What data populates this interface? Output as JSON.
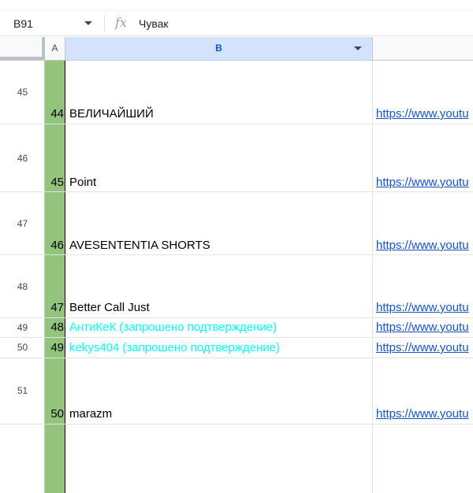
{
  "formula_bar": {
    "name_box": "B91",
    "fx_label": "fx",
    "formula": "Чувак"
  },
  "columns": {
    "a": "A",
    "b": "B"
  },
  "rows": [
    {
      "row_number": "45",
      "a": "44",
      "b": "ВЕЛИЧАЙШИЙ",
      "c": "https://www.youtu",
      "b_color": "#000000"
    },
    {
      "row_number": "46",
      "a": "45",
      "b": "Point",
      "c": "https://www.youtu",
      "b_color": "#000000"
    },
    {
      "row_number": "47",
      "a": "46",
      "b": "AVESENTENTIA SHORTS",
      "c": "https://www.youtu",
      "b_color": "#000000"
    },
    {
      "row_number": "48",
      "a": "47",
      "b": "Better Call Just",
      "c": "https://www.youtu",
      "b_color": "#000000"
    },
    {
      "row_number": "49",
      "a": "48",
      "b": "АнтиКеК (запрошено подтверждение)",
      "c": "https://www.youtu",
      "b_color": "#00ffff"
    },
    {
      "row_number": "50",
      "a": "49",
      "b": "kekys404 (запрошено подтверждение)",
      "c": "https://www.youtu",
      "b_color": "#00ffff"
    },
    {
      "row_number": "51",
      "a": "50",
      "b": "marazm",
      "c": "https://www.youtu",
      "b_color": "#000000"
    }
  ],
  "colors": {
    "column_a_fill": "#93c47d",
    "selected_header": "#d3e3fd",
    "link": "#1155cc"
  }
}
